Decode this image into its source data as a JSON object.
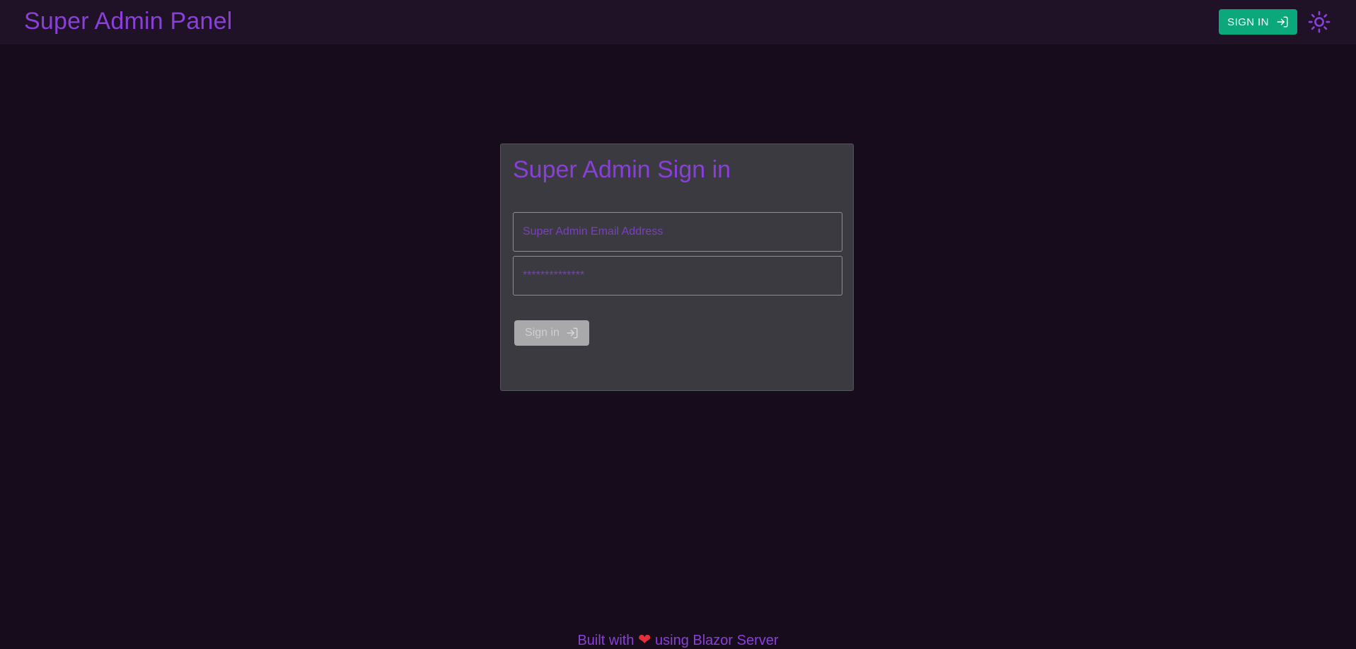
{
  "header": {
    "app_title": "Super Admin Panel",
    "signin_label": "SIGN IN",
    "signin_icon": "login-icon",
    "theme_icon": "sun-icon"
  },
  "login_card": {
    "title": "Super Admin Sign in",
    "email_placeholder": "Super Admin Email Address",
    "password_placeholder": "**************",
    "signin_label": "Sign in",
    "signin_icon": "login-icon"
  },
  "footer": {
    "prefix": "Built with",
    "heart": "❤",
    "suffix": "using Blazor Server"
  },
  "colors": {
    "accent": "#8a3fd8",
    "primary_button": "#0aa87a",
    "background": "#160c1b",
    "heart": "#e0313d"
  }
}
